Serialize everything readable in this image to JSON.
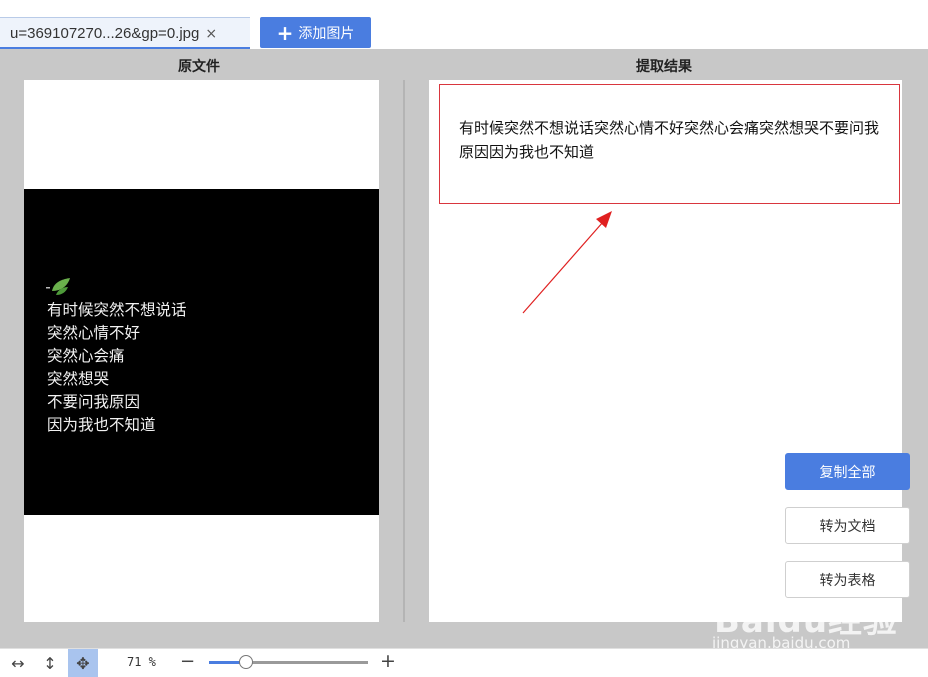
{
  "tabs": {
    "file_name": "u=369107270...26&gp=0.jpg",
    "close_icon": "×",
    "add_button": "添加图片",
    "add_icon": "+"
  },
  "panels": {
    "left_title": "原文件",
    "right_title": "提取结果"
  },
  "source_image": {
    "lines": [
      "有时候突然不想说话",
      "突然心情不好",
      "突然心会痛",
      "突然想哭",
      "不要问我原因",
      "因为我也不知道"
    ]
  },
  "result": {
    "text": "有时候突然不想说话突然心情不好突然心会痛突然想哭不要问我原因因为我也不知道"
  },
  "actions": {
    "copy_all": "复制全部",
    "to_doc": "转为文档",
    "to_table": "转为表格"
  },
  "toolbar": {
    "fit_width_icon": "↔",
    "fit_height_icon": "↕",
    "move_icon": "✥",
    "zoom_text": "71 %",
    "zoom_fraction": 0.23,
    "minus_icon": "−",
    "plus_icon": "+"
  },
  "watermark": {
    "main": "Baidu经验",
    "sub": "jingyan.baidu.com"
  },
  "colors": {
    "accent": "#4a7de0",
    "highlight_box": "#d9363e",
    "workspace_bg": "#c8c8c8"
  }
}
